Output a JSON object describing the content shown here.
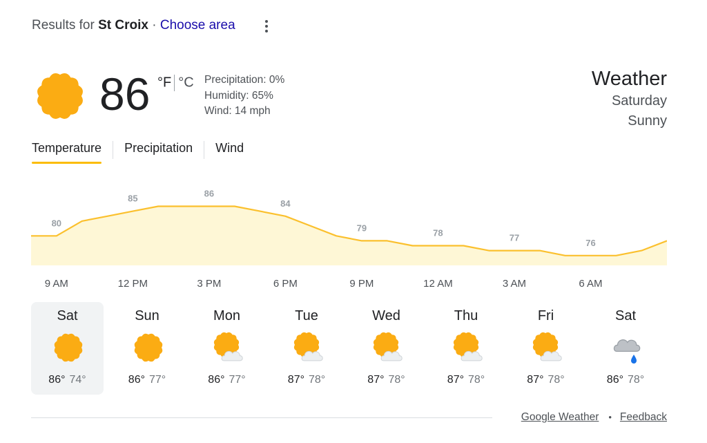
{
  "header": {
    "results_prefix": "Results for",
    "place": "St Croix",
    "separator": "·",
    "choose_area": "Choose area"
  },
  "current": {
    "temperature": "86",
    "unit_f": "°F",
    "unit_c": "°C",
    "icon": "sun-icon",
    "precipitation": "Precipitation: 0%",
    "humidity": "Humidity: 65%",
    "wind": "Wind: 14 mph"
  },
  "title": {
    "heading": "Weather",
    "day": "Saturday",
    "condition": "Sunny"
  },
  "tabs": [
    {
      "label": "Temperature",
      "active": true
    },
    {
      "label": "Precipitation",
      "active": false
    },
    {
      "label": "Wind",
      "active": false
    }
  ],
  "chart_data": {
    "type": "area",
    "labeled_points": [
      80,
      85,
      86,
      84,
      79,
      78,
      77,
      76
    ],
    "hours": [
      "9 AM",
      "12 PM",
      "3 PM",
      "6 PM",
      "9 PM",
      "12 AM",
      "3 AM",
      "6 AM"
    ],
    "temperatures": [
      80,
      80,
      83,
      84,
      85,
      86,
      86,
      86,
      86,
      85,
      84,
      82,
      80,
      79,
      79,
      78,
      78,
      78,
      77,
      77,
      77,
      76,
      76,
      76,
      77,
      79
    ],
    "ylim": [
      74,
      90
    ],
    "colors": {
      "line": "#fbc02d",
      "fill": "#fef7d6",
      "label": "#9aa0a6"
    }
  },
  "days": [
    {
      "name": "Sat",
      "icon": "sun-icon",
      "high": "86°",
      "low": "74°",
      "selected": true
    },
    {
      "name": "Sun",
      "icon": "sun-icon",
      "high": "86°",
      "low": "77°",
      "selected": false
    },
    {
      "name": "Mon",
      "icon": "partly-cloudy-icon",
      "high": "86°",
      "low": "77°",
      "selected": false
    },
    {
      "name": "Tue",
      "icon": "partly-cloudy-icon",
      "high": "87°",
      "low": "78°",
      "selected": false
    },
    {
      "name": "Wed",
      "icon": "partly-cloudy-icon",
      "high": "87°",
      "low": "78°",
      "selected": false
    },
    {
      "name": "Thu",
      "icon": "partly-cloudy-icon",
      "high": "87°",
      "low": "78°",
      "selected": false
    },
    {
      "name": "Fri",
      "icon": "partly-cloudy-icon",
      "high": "87°",
      "low": "78°",
      "selected": false
    },
    {
      "name": "Sat",
      "icon": "rain-cloud-icon",
      "high": "86°",
      "low": "78°",
      "selected": false
    }
  ],
  "footer": {
    "source": "Google Weather",
    "dot": "•",
    "feedback": "Feedback"
  },
  "colors": {
    "sun": "#fbac13",
    "accent": "#fbbc04",
    "link": "#1a0dab",
    "cloud": "#eceff1",
    "rain_cloud": "#bdc1c6",
    "rain_drop": "#1a73e8"
  }
}
